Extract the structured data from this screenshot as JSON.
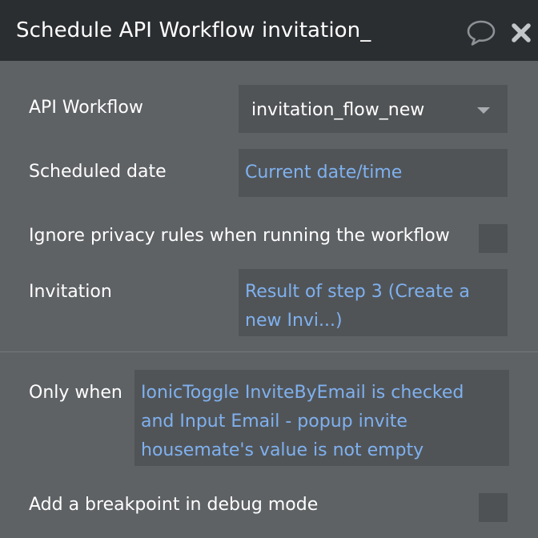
{
  "header": {
    "title": "Schedule API Workflow invitation_",
    "comment_icon": "speech-bubble-icon",
    "close_icon": "close-x-icon"
  },
  "fields": {
    "api_workflow": {
      "label": "API Workflow",
      "value": "invitation_flow_new"
    },
    "scheduled_date": {
      "label": "Scheduled date",
      "value": "Current date/time"
    },
    "ignore_privacy": {
      "label": "Ignore privacy rules when running the workflow",
      "checked": false
    },
    "invitation": {
      "label": "Invitation",
      "value_line1": "Result of step 3 (Create a",
      "value_line2": "new Invi...)"
    },
    "only_when": {
      "label": "Only when",
      "value_line1": "IonicToggle InviteByEmail is checked",
      "value_line2": "and Input Email - popup invite",
      "value_line3": "housemate's value is not empty"
    },
    "breakpoint": {
      "label": "Add a breakpoint in debug mode",
      "checked": false
    }
  },
  "colors": {
    "header_bg": "#2b2e31",
    "panel_bg": "#5f6265",
    "field_bg": "#515457",
    "dynamic_text": "#7fb1ef"
  }
}
